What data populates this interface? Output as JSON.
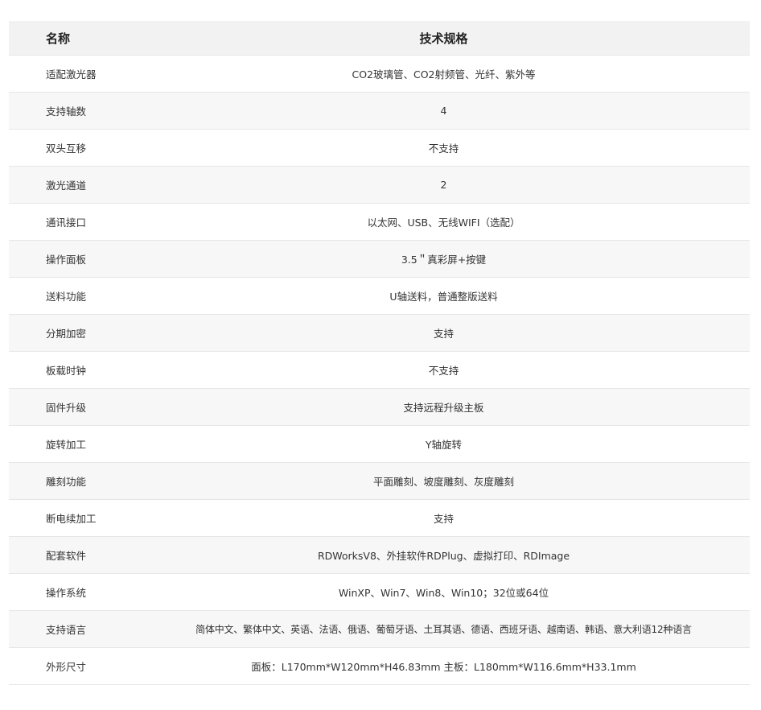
{
  "table": {
    "headers": {
      "name": "名称",
      "spec": "技术规格"
    },
    "rows": [
      {
        "name": "适配激光器",
        "spec": "CO2玻璃管、CO2射频管、光纤、紫外等"
      },
      {
        "name": "支持轴数",
        "spec": "4"
      },
      {
        "name": "双头互移",
        "spec": "不支持"
      },
      {
        "name": "激光通道",
        "spec": "2"
      },
      {
        "name": "通讯接口",
        "spec": "以太网、USB、无线WIFI（选配）"
      },
      {
        "name": "操作面板",
        "spec": "3.5＂真彩屏+按键"
      },
      {
        "name": "送料功能",
        "spec": "U轴送料，普通整版送料"
      },
      {
        "name": "分期加密",
        "spec": "支持"
      },
      {
        "name": "板载时钟",
        "spec": "不支持"
      },
      {
        "name": "固件升级",
        "spec": "支持远程升级主板"
      },
      {
        "name": "旋转加工",
        "spec": "Y轴旋转"
      },
      {
        "name": "雕刻功能",
        "spec": "平面雕刻、坡度雕刻、灰度雕刻"
      },
      {
        "name": "断电续加工",
        "spec": "支持"
      },
      {
        "name": "配套软件",
        "spec": "RDWorksV8、外挂软件RDPlug、虚拟打印、RDImage"
      },
      {
        "name": "操作系统",
        "spec": "WinXP、Win7、Win8、Win10；32位或64位"
      },
      {
        "name": "支持语言",
        "spec": "简体中文、繁体中文、英语、法语、俄语、葡萄牙语、土耳其语、德语、西班牙语、越南语、韩语、意大利语12种语言"
      },
      {
        "name": "外形尺寸",
        "spec": "面板：L170mm*W120mm*H46.83mm 主板：L180mm*W116.6mm*H33.1mm"
      }
    ]
  }
}
